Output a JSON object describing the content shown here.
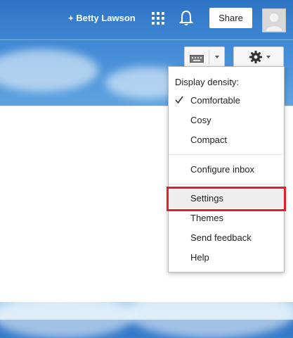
{
  "header": {
    "user_name": "+ Betty Lawson",
    "share_label": "Share",
    "apps_icon": "apps-grid-icon",
    "notifications_icon": "bell-icon",
    "avatar_icon": "avatar-icon"
  },
  "toolbar": {
    "keyboard_icon": "keyboard-icon",
    "settings_icon": "gear-icon"
  },
  "menu": {
    "density_header": "Display density:",
    "density_options": [
      "Comfortable",
      "Cosy",
      "Compact"
    ],
    "selected_density": "Comfortable",
    "configure_inbox": "Configure inbox",
    "settings": "Settings",
    "themes": "Themes",
    "send_feedback": "Send feedback",
    "help": "Help",
    "highlight_color": "#e0202a"
  }
}
